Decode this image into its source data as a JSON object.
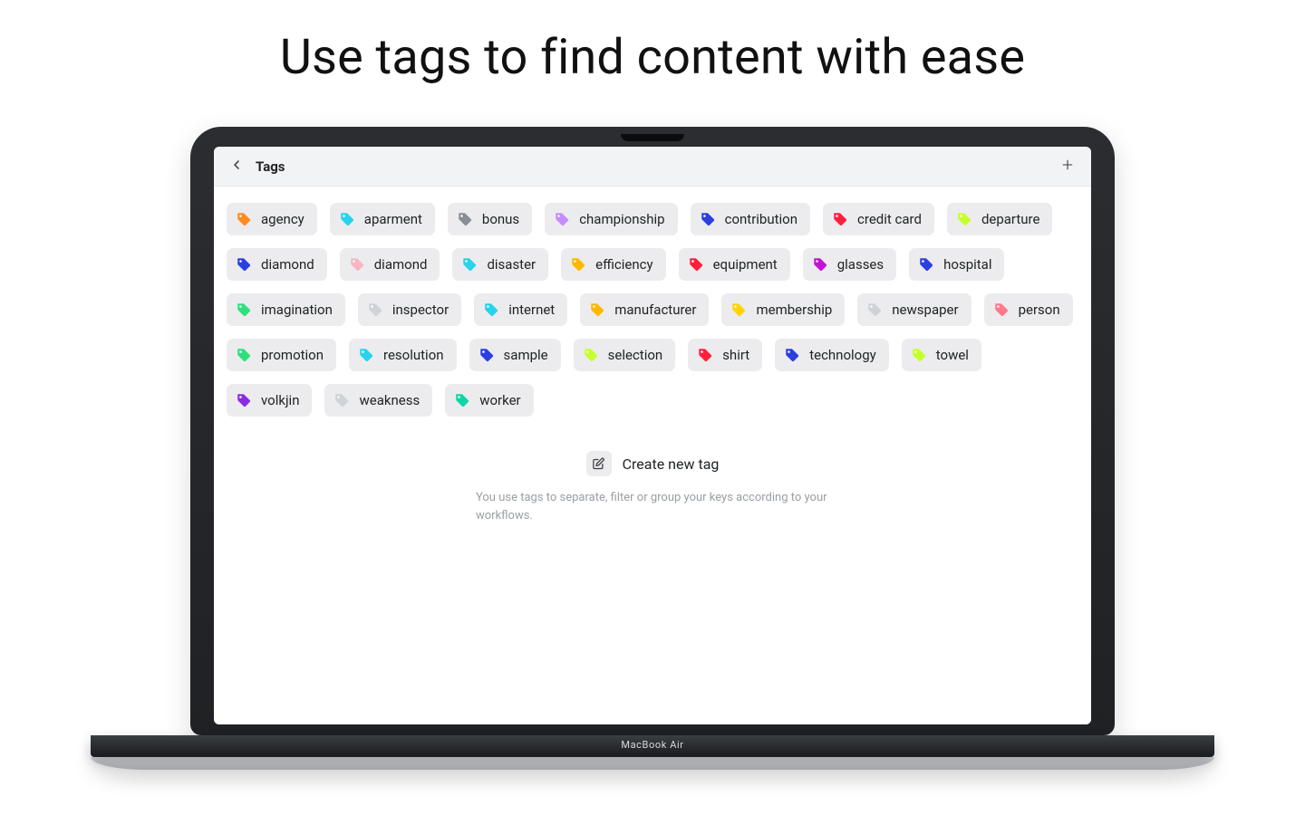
{
  "hero": {
    "title": "Use tags to find content with ease"
  },
  "device": {
    "label": "MacBook Air"
  },
  "header": {
    "title": "Tags"
  },
  "actions": {
    "create_label": "Create new tag",
    "help_text": "You use tags to separate, filter or group your keys according to your workflows."
  },
  "colors": {
    "orange": "#ff8a1f",
    "cyan": "#27d3ed",
    "gray": "#8a8d93",
    "lavender": "#c58cff",
    "blue": "#2b3fe0",
    "red": "#ff1f3d",
    "lime": "#c6ff2e",
    "pink": "#f7b6c2",
    "amber": "#ffb800",
    "magenta": "#c213d6",
    "yellow": "#ffd400",
    "salmon": "#ff7a8a",
    "green": "#2de07a",
    "lightgray": "#cfd2d7",
    "purple": "#8a2de0",
    "teal": "#0fd6a6"
  },
  "tags": [
    {
      "label": "agency",
      "color": "orange"
    },
    {
      "label": "aparment",
      "color": "cyan"
    },
    {
      "label": "bonus",
      "color": "gray"
    },
    {
      "label": "championship",
      "color": "lavender"
    },
    {
      "label": "contribution",
      "color": "blue"
    },
    {
      "label": "credit card",
      "color": "red"
    },
    {
      "label": "departure",
      "color": "lime"
    },
    {
      "label": "diamond",
      "color": "blue"
    },
    {
      "label": "diamond",
      "color": "pink"
    },
    {
      "label": "disaster",
      "color": "cyan"
    },
    {
      "label": "efficiency",
      "color": "amber"
    },
    {
      "label": "equipment",
      "color": "red"
    },
    {
      "label": "glasses",
      "color": "magenta"
    },
    {
      "label": "hospital",
      "color": "blue"
    },
    {
      "label": "imagination",
      "color": "green"
    },
    {
      "label": "inspector",
      "color": "lightgray"
    },
    {
      "label": "internet",
      "color": "cyan"
    },
    {
      "label": "manufacturer",
      "color": "amber"
    },
    {
      "label": "membership",
      "color": "yellow"
    },
    {
      "label": "newspaper",
      "color": "lightgray"
    },
    {
      "label": "person",
      "color": "salmon"
    },
    {
      "label": "promotion",
      "color": "green"
    },
    {
      "label": "resolution",
      "color": "cyan"
    },
    {
      "label": "sample",
      "color": "blue"
    },
    {
      "label": "selection",
      "color": "lime"
    },
    {
      "label": "shirt",
      "color": "red"
    },
    {
      "label": "technology",
      "color": "blue"
    },
    {
      "label": "towel",
      "color": "lime"
    },
    {
      "label": "volkjin",
      "color": "purple"
    },
    {
      "label": "weakness",
      "color": "lightgray"
    },
    {
      "label": "worker",
      "color": "teal"
    }
  ]
}
